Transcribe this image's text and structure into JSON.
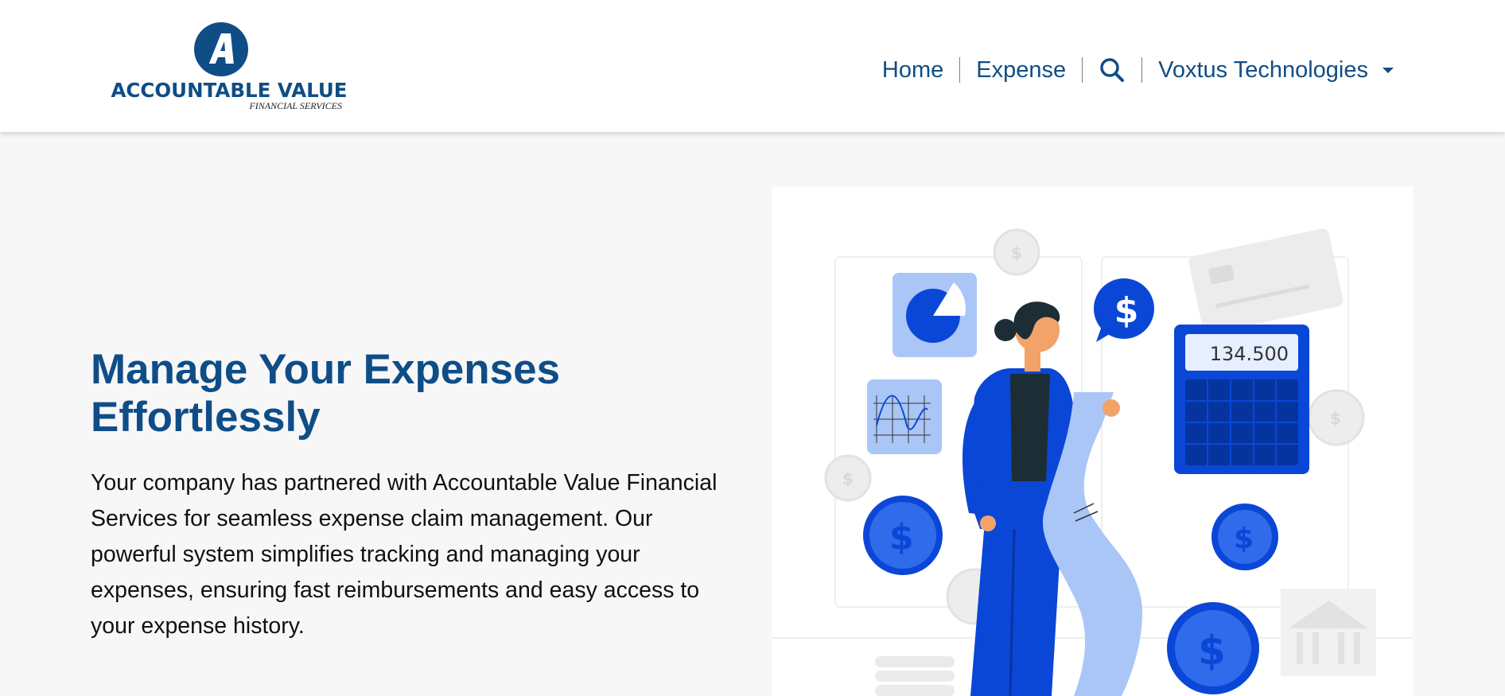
{
  "header": {
    "logo": {
      "mark_letter": "A",
      "name": "ACCOUNTABLE VALUE",
      "subtitle": "FINANCIAL SERVICES"
    },
    "nav": {
      "home_label": "Home",
      "expense_label": "Expense",
      "search_icon": "search-icon",
      "company_label": "Voxtus Technologies",
      "dropdown_icon": "caret-down-icon"
    }
  },
  "hero": {
    "title": "Manage Your Expenses Effortlessly",
    "description": "Your company has partnered with Accountable Value Financial Services for seamless expense claim management. Our powerful system simplifies tracking and managing your expenses, ensuring fast reimbursements and easy access to your expense history."
  },
  "illustration": {
    "calculator_display": "134.500",
    "coin_symbol": "$"
  },
  "colors": {
    "brand": "#0f4d86",
    "accent": "#0a47d6",
    "accent_light": "#a9c6f7",
    "background": "#f7f7f8"
  }
}
